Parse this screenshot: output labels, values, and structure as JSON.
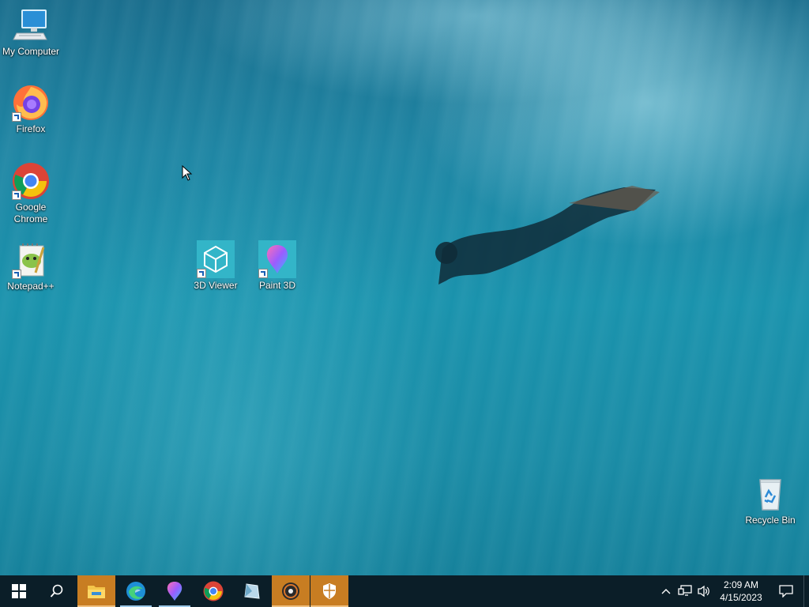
{
  "desktop": {
    "icons": [
      {
        "label": "My Computer",
        "icon": "monitor-icon"
      },
      {
        "label": "Firefox",
        "icon": "firefox-icon"
      },
      {
        "label": "Google Chrome",
        "icon": "chrome-icon"
      },
      {
        "label": "Notepad++",
        "icon": "notepadpp-icon"
      },
      {
        "label": "3D Viewer",
        "icon": "cube-icon"
      },
      {
        "label": "Paint 3D",
        "icon": "paint3d-icon"
      },
      {
        "label": "Recycle Bin",
        "icon": "recycle-bin-icon"
      }
    ]
  },
  "taskbar": {
    "buttons": [
      {
        "name": "start",
        "icon": "windows-logo-icon"
      },
      {
        "name": "search",
        "icon": "search-icon"
      },
      {
        "name": "file-explorer",
        "icon": "folder-icon"
      },
      {
        "name": "edge",
        "icon": "edge-icon"
      },
      {
        "name": "paint-3d",
        "icon": "paint3d-icon"
      },
      {
        "name": "chrome",
        "icon": "chrome-icon"
      },
      {
        "name": "app",
        "icon": "crystal-icon"
      },
      {
        "name": "media",
        "icon": "disc-icon"
      },
      {
        "name": "security",
        "icon": "shield-icon"
      }
    ],
    "tray": {
      "time": "2:09 AM",
      "date": "4/15/2023"
    }
  },
  "colors": {
    "taskbar_bg": "#0b1e28",
    "active_button": "#c87d22",
    "desktop_water": "#1a8ca6"
  }
}
